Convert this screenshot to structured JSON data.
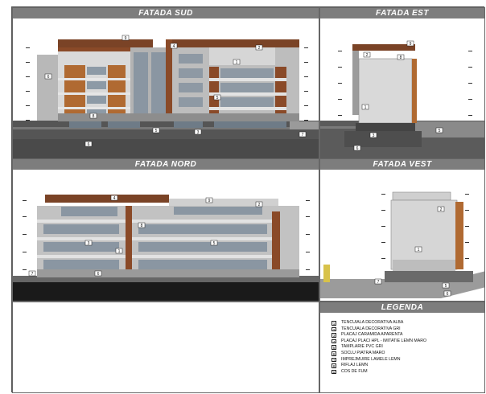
{
  "panels": {
    "sud": {
      "title": "FATADA SUD"
    },
    "est": {
      "title": "FATADA EST"
    },
    "nord": {
      "title": "FATADA NORD"
    },
    "vest": {
      "title": "FATADA VEST"
    },
    "legenda": {
      "title": "LEGENDA"
    }
  },
  "legend": [
    {
      "num": "1",
      "text": "TENCUIALA DECORATIVA ALBA"
    },
    {
      "num": "2",
      "text": "TENCUIALA DECORATIVA GRI"
    },
    {
      "num": "3",
      "text": "PLACAJ CARAMIDA APARENTA"
    },
    {
      "num": "4",
      "text": "PLACAJ PLACI HPL - IMITATIE LEMN MARO"
    },
    {
      "num": "5",
      "text": "TAMPLARIE PVC GRI"
    },
    {
      "num": "6",
      "text": "SOCLU PIATRA MARO"
    },
    {
      "num": "7",
      "text": "IMPREJMUIRE LAMELE LEMN"
    },
    {
      "num": "8",
      "text": "RIFLAJ LEMN"
    },
    {
      "num": "9",
      "text": "COS DE FUM"
    }
  ],
  "tags": {
    "t1": "1",
    "t2": "2",
    "t3": "3",
    "t4": "4",
    "t5": "5",
    "t6": "6",
    "t7": "7",
    "t8": "8",
    "t9": "9"
  },
  "colors": {
    "brick": "#8a4a28",
    "wood": "#b06a32",
    "plaster_white": "#dcdcdc",
    "plaster_grey": "#a9a9a9",
    "glass": "#a8b2bc",
    "dark": "#3e3e3e",
    "ground": "#5a5a5a"
  }
}
